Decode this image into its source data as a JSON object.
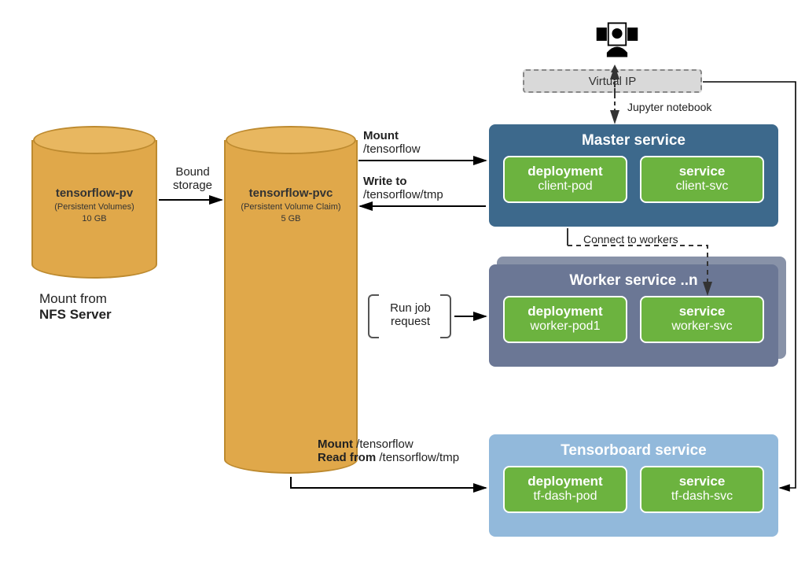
{
  "cylinders": {
    "pv": {
      "title": "tensorflow-pv",
      "subtitle": "(Persistent Volumes)",
      "size": "10 GB"
    },
    "pvc": {
      "title": "tensorflow-pvc",
      "subtitle": "(Persistent Volume Claim)",
      "size": "5 GB"
    }
  },
  "nfs": {
    "line1": "Mount from",
    "line2": "NFS Server"
  },
  "vip": "Virtual IP",
  "panels": {
    "master": {
      "title": "Master service",
      "dep": {
        "head": "deployment",
        "sub": "client-pod"
      },
      "svc": {
        "head": "service",
        "sub": "client-svc"
      }
    },
    "worker": {
      "title": "Worker service ..n",
      "dep": {
        "head": "deployment",
        "sub": "worker-pod1"
      },
      "svc": {
        "head": "service",
        "sub": "worker-svc"
      }
    },
    "tensor": {
      "title": "Tensorboard service",
      "dep": {
        "head": "deployment",
        "sub": "tf-dash-pod"
      },
      "svc": {
        "head": "service",
        "sub": "tf-dash-svc"
      }
    }
  },
  "labels": {
    "bound": "Bound storage",
    "mount": {
      "b": "Mount",
      "rest": "/tensorflow"
    },
    "writeto": {
      "b": "Write to",
      "rest": "/tensorflow/tmp"
    },
    "jupyter": "Jupyter notebook",
    "connect": "Connect to workers",
    "runjob": "Run job request",
    "mount2": {
      "b": "Mount",
      "rest": "/tensorflow"
    },
    "readfrom": {
      "b": "Read from",
      "rest": "/tensorflow/tmp"
    }
  }
}
